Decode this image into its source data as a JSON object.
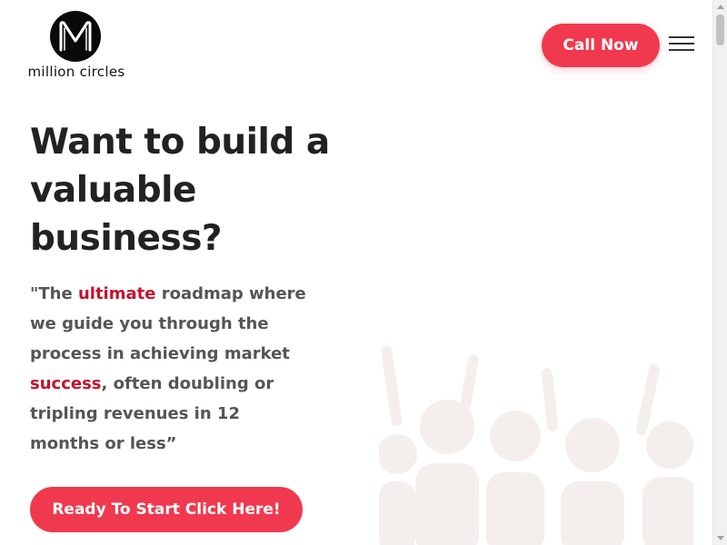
{
  "brand": {
    "logo_letter": "M",
    "name": "million circles"
  },
  "header": {
    "call_label": "Call Now",
    "menu_icon": "hamburger-menu-icon"
  },
  "hero": {
    "headline": "Want to build a valuable business?",
    "quote": {
      "part1": "\"The ",
      "highlight1": "ultimate",
      "part2": " roadmap where we guide you through the process in achieving market ",
      "highlight2": "success",
      "part3": ", often doubling or tripling revenues in 12 months or less”"
    },
    "cta_label": "Ready To Start Click Here!",
    "illustration": "cheering-people-illustration"
  },
  "colors": {
    "accent": "#f0394f",
    "highlight": "#c8102e",
    "heading": "#222222",
    "body": "#555555"
  }
}
